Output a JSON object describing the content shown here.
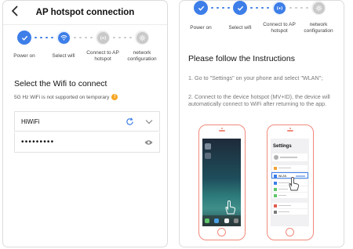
{
  "left": {
    "header": {
      "title": "AP hotspot connection",
      "back_icon": "chevron-left-icon"
    },
    "steps": [
      {
        "label": "Power on",
        "state": "done"
      },
      {
        "label": "Select wifi",
        "state": "active"
      },
      {
        "label": "Connect to AP hotspot",
        "state": "pending"
      },
      {
        "label": "network configuration",
        "state": "pending"
      }
    ],
    "section_title": "Select the Wifi to connect",
    "note": "5G Hz WiFi is not supported on temporary",
    "note_icon": "warning-icon",
    "wifi_name": "HiWiFi",
    "password": "•••••••••"
  },
  "right": {
    "steps": [
      {
        "label": "Power on",
        "state": "done"
      },
      {
        "label": "Select wifi",
        "state": "done"
      },
      {
        "label": "Connect to AP hotspot",
        "state": "active"
      },
      {
        "label": "network configuration",
        "state": "pending"
      }
    ],
    "instructions_title": "Please follow the Instructions",
    "instruction_1": "1. Go to \"Settings\" on your phone and select \"WLAN\";",
    "instruction_2": "2. Connect to the device hotspot (MV+ID), the device will automatically connect to WiFi after returning to the app.",
    "phone2_header": "Settings",
    "phone2_wlan": "WLAN"
  },
  "colors": {
    "accent": "#3d7ee8",
    "pending": "#c9c9c9",
    "phone_outline": "#f08a7b",
    "warning": "#f5a623"
  }
}
